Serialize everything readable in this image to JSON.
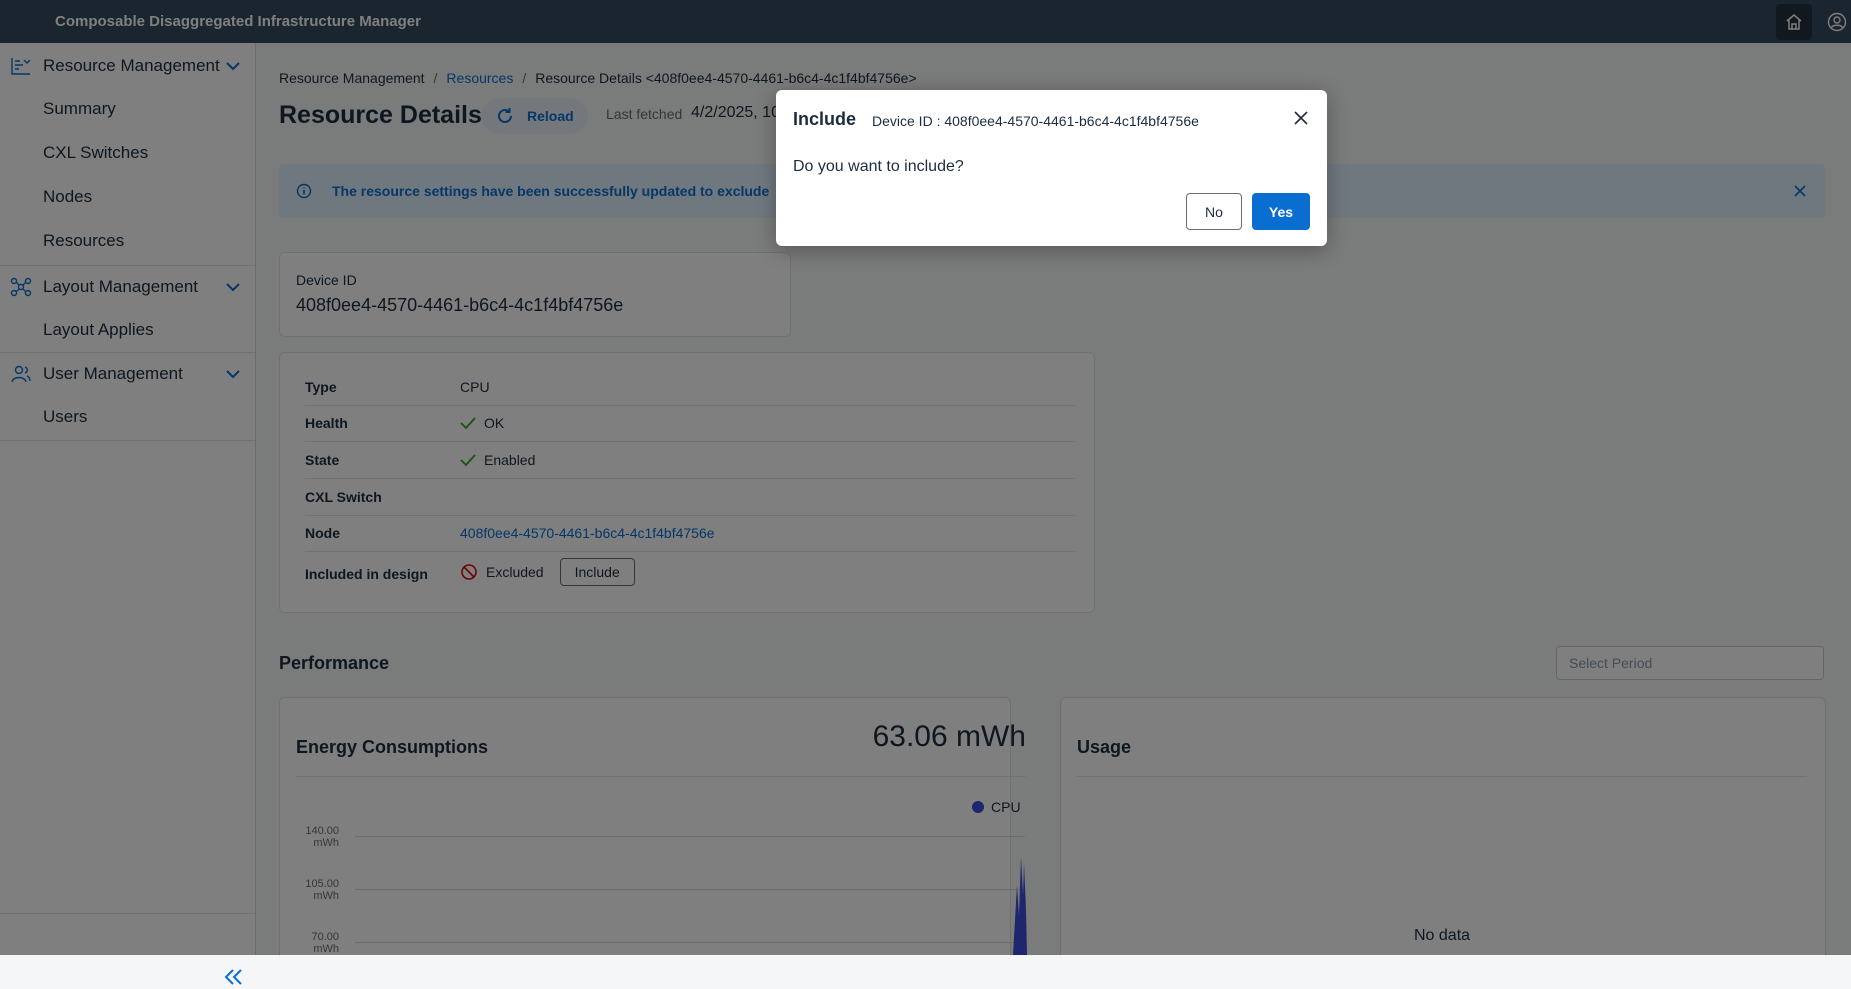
{
  "shell": {
    "title": "Composable Disaggregated Infrastructure Manager",
    "home_icon": "home-icon",
    "user_icon": "user-icon"
  },
  "sidebar": {
    "groups": [
      {
        "label": "Resource Management",
        "icon": "resource-management-icon",
        "items": [
          {
            "label": "Summary"
          },
          {
            "label": "CXL Switches"
          },
          {
            "label": "Nodes"
          },
          {
            "label": "Resources"
          }
        ]
      },
      {
        "label": "Layout Management",
        "icon": "layout-management-icon",
        "items": [
          {
            "label": "Layout Applies"
          }
        ]
      },
      {
        "label": "User Management",
        "icon": "user-management-icon",
        "items": [
          {
            "label": "Users"
          }
        ]
      }
    ]
  },
  "breadcrumb": {
    "root": "Resource Management",
    "resources": "Resources",
    "current": "Resource Details <408f0ee4-4570-4461-b6c4-4c1f4bf4756e>"
  },
  "page": {
    "title": "Resource Details",
    "reload_label": "Reload",
    "last_fetched_label": "Last fetched",
    "last_fetched_value": "4/2/2025, 10"
  },
  "banner": {
    "message": "The resource settings have been successfully updated to exclude"
  },
  "device": {
    "label": "Device ID",
    "value": "408f0ee4-4570-4461-b6c4-4c1f4bf4756e"
  },
  "details": {
    "type_label": "Type",
    "type_value": "CPU",
    "health_label": "Health",
    "health_value": "OK",
    "state_label": "State",
    "state_value": "Enabled",
    "cxl_label": "CXL Switch",
    "cxl_value": "",
    "node_label": "Node",
    "node_value": "408f0ee4-4570-4461-b6c4-4c1f4bf4756e",
    "included_label": "Included in design",
    "included_value": "Excluded",
    "include_button": "Include"
  },
  "performance": {
    "title": "Performance",
    "period_placeholder": "Select Period",
    "energy": {
      "title": "Energy Consumptions",
      "value": "63.06 mWh",
      "legend": "CPU",
      "series_color": "#3c4fdc",
      "y_ticks": [
        {
          "v": "140.00",
          "u": "mWh"
        },
        {
          "v": "105.00",
          "u": "mWh"
        },
        {
          "v": "70.00",
          "u": "mWh"
        }
      ]
    },
    "usage": {
      "title": "Usage",
      "empty": "No data"
    }
  },
  "dialog": {
    "title": "Include",
    "subtitle": "Device ID : 408f0ee4-4570-4461-b6c4-4c1f4bf4756e",
    "question": "Do you want to include?",
    "no_label": "No",
    "yes_label": "Yes"
  }
}
